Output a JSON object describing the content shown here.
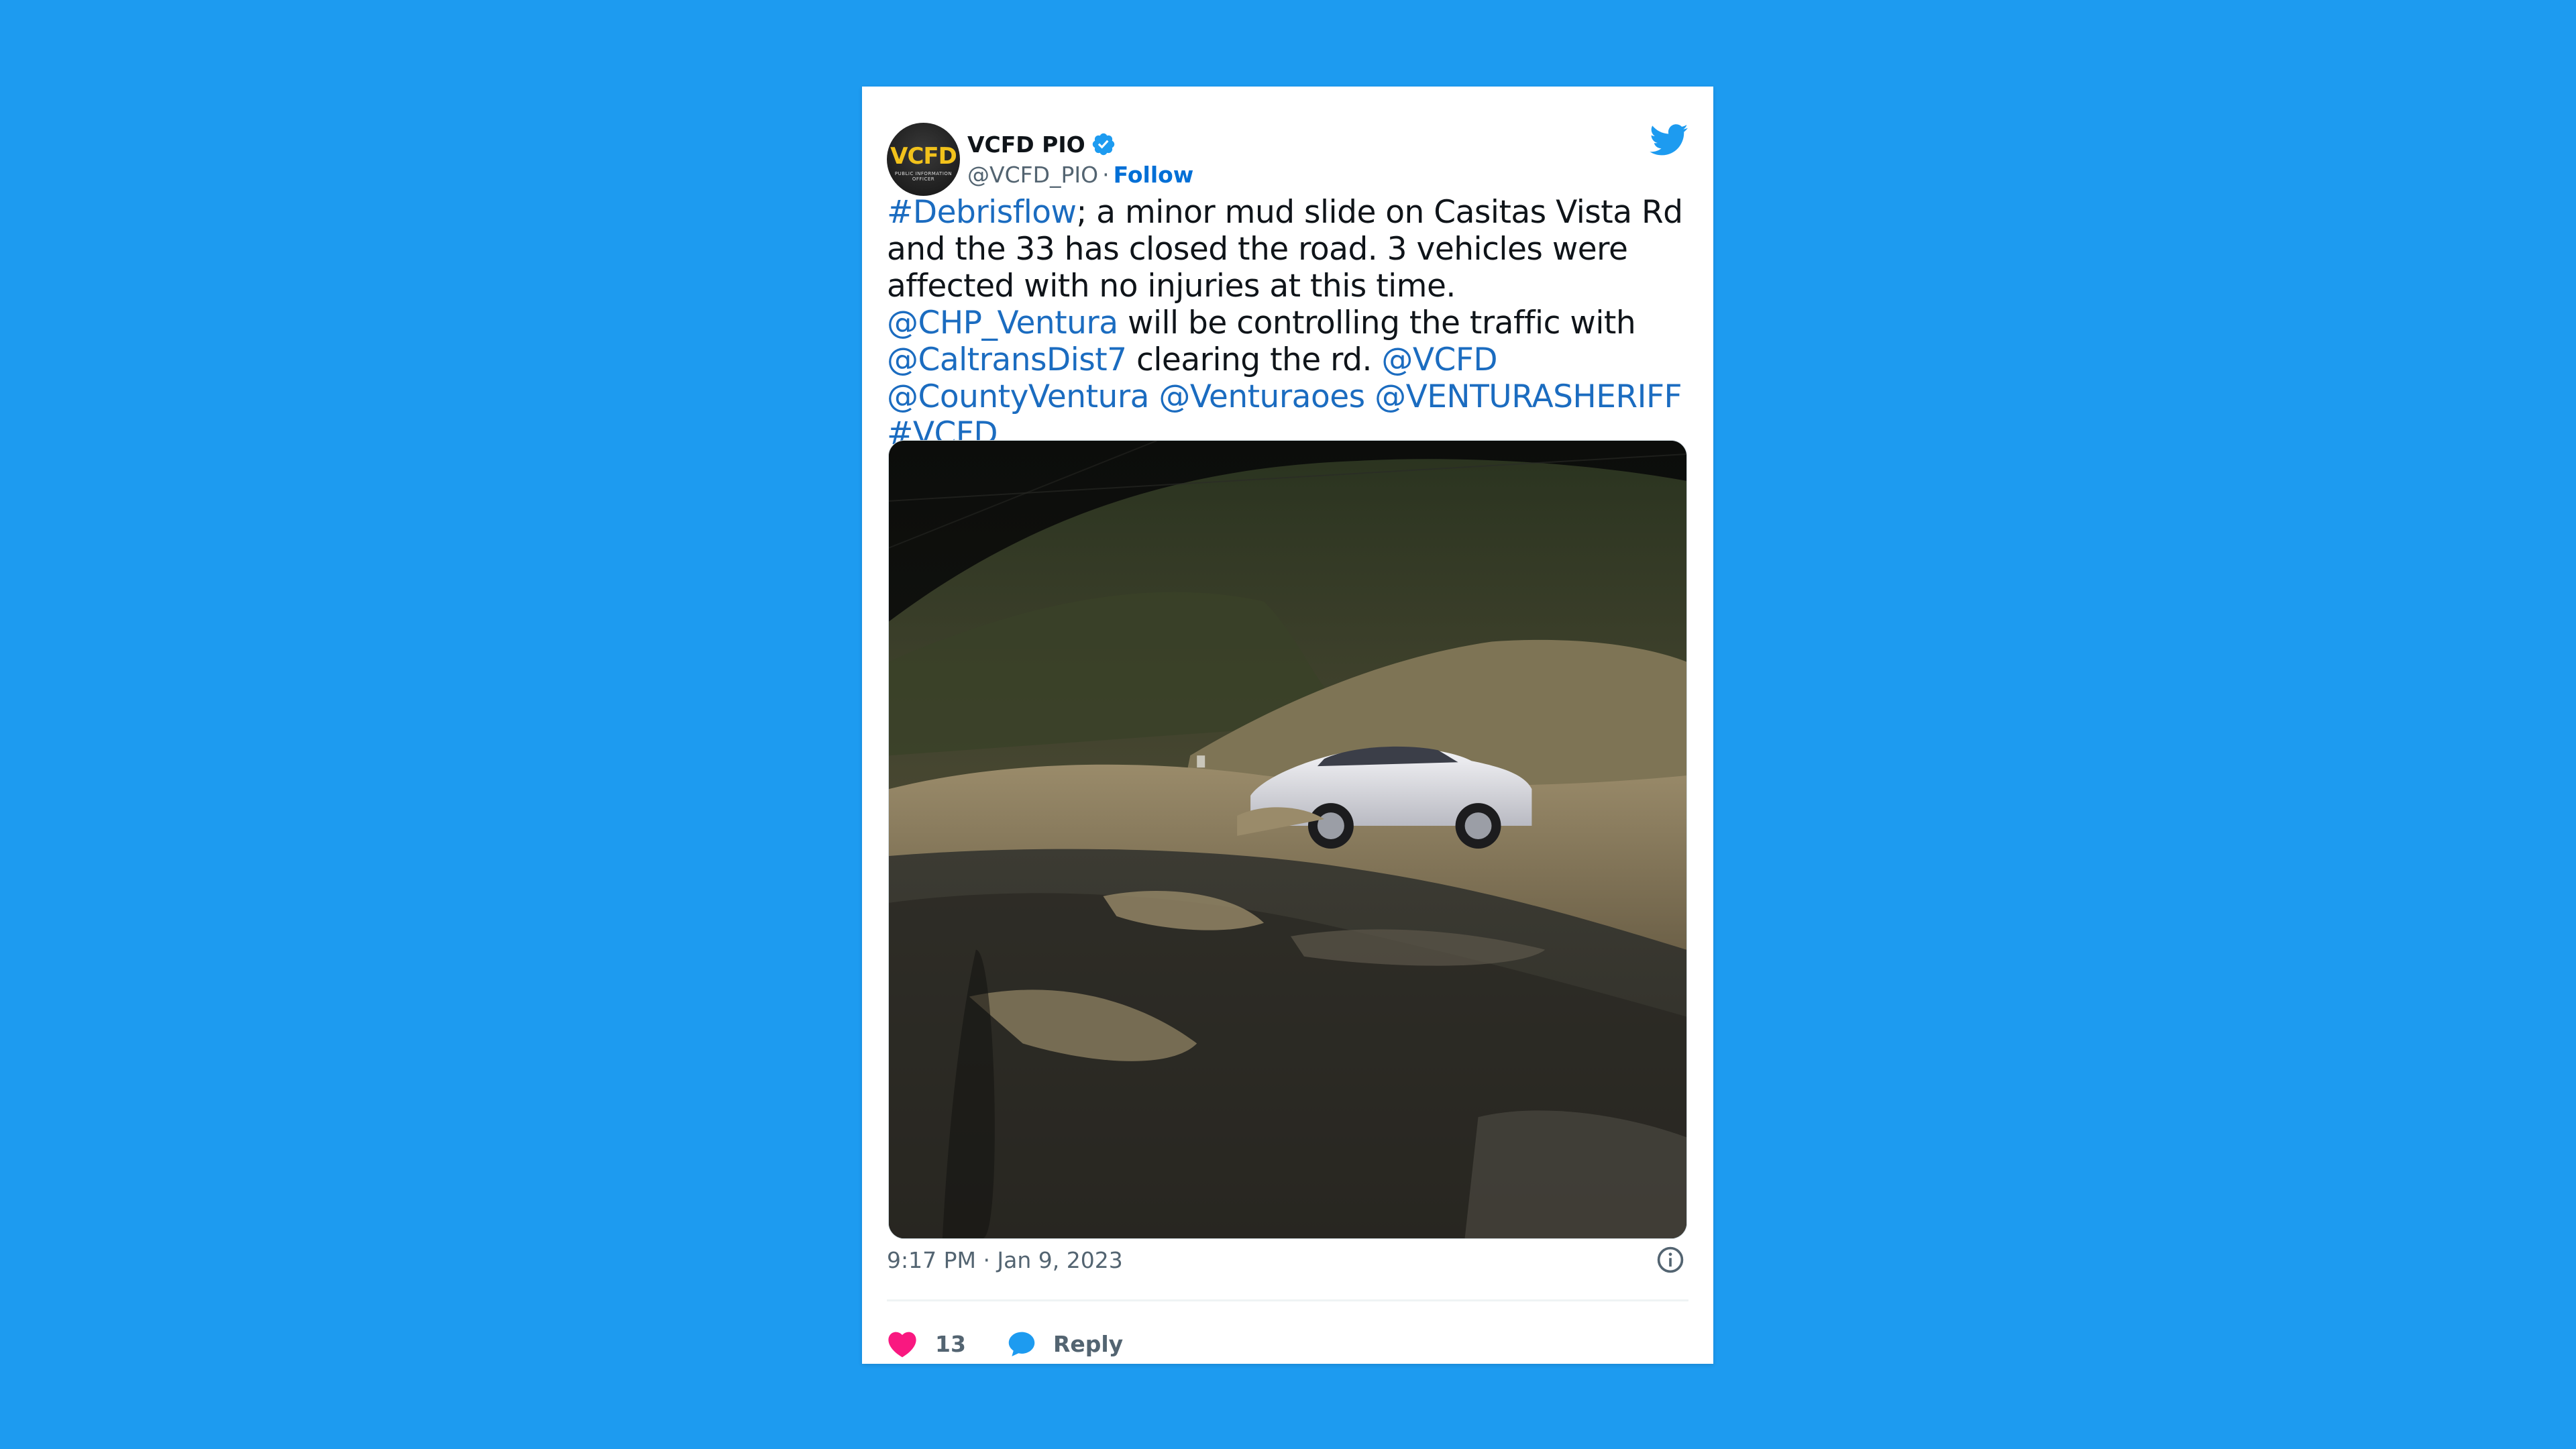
{
  "author": {
    "name": "VCFD PIO",
    "handle": "@VCFD_PIO",
    "separator": "·",
    "follow_label": "Follow",
    "avatar_text": "VCFD",
    "avatar_subtext": "PUBLIC INFORMATION OFFICER"
  },
  "tweet": {
    "segments": [
      {
        "text": "#Debrisflow",
        "link": true
      },
      {
        "text": "; a minor mud slide on Casitas Vista Rd and the 33 has closed the road. 3 vehicles were affected with no injuries at this time. ",
        "link": false
      },
      {
        "text": "@CHP_Ventura",
        "link": true
      },
      {
        "text": " will be controlling the traffic with ",
        "link": false
      },
      {
        "text": "@CaltransDist7",
        "link": true
      },
      {
        "text": " clearing the rd. ",
        "link": false
      },
      {
        "text": "@VCFD",
        "link": true
      },
      {
        "text": " ",
        "link": false
      },
      {
        "text": "@CountyVentura",
        "link": true
      },
      {
        "text": " ",
        "link": false
      },
      {
        "text": "@Venturaoes",
        "link": true
      },
      {
        "text": " ",
        "link": false
      },
      {
        "text": "@VENTURASHERIFF",
        "link": true
      },
      {
        "text": " ",
        "link": false
      },
      {
        "text": "#VCFD",
        "link": true
      }
    ]
  },
  "timestamp": "9:17 PM · Jan 9, 2023",
  "actions": {
    "like_count": "13",
    "reply_label": "Reply"
  },
  "colors": {
    "background": "#1d9bf0",
    "link": "#1b6cc0",
    "like": "#f91880",
    "reply": "#1d9bf0",
    "verified": "#1d9bf0"
  },
  "icons": {
    "verified": "verified-badge-icon",
    "brand": "twitter-bird-icon",
    "info": "info-icon",
    "like": "heart-icon",
    "reply": "speech-bubble-icon"
  }
}
